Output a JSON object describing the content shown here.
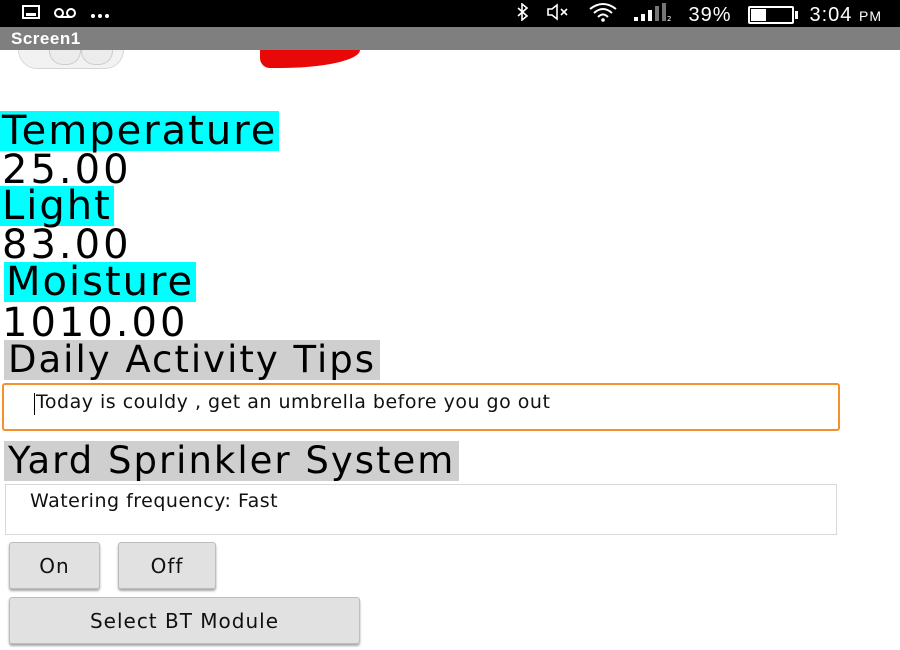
{
  "status_bar": {
    "left_icons": [
      "image-icon",
      "voicemail-icon",
      "more-dots-icon"
    ],
    "right_icons": [
      "bluetooth-icon",
      "mute-icon",
      "wifi-icon",
      "signal-icon"
    ],
    "battery_text": "39%",
    "battery_level": 0.39,
    "time": "3:04",
    "ampm": "PM"
  },
  "title_bar": {
    "title": "Screen1"
  },
  "sensors": {
    "temperature": {
      "label": "Temperature",
      "value": "25.00"
    },
    "light": {
      "label": "Light",
      "value": "83.00"
    },
    "moisture": {
      "label": "Moisture",
      "value": "1010.00"
    }
  },
  "tips": {
    "heading": "Daily Activity Tips",
    "text": "Today is couldy , get an umbrella before you go out"
  },
  "sprinkler": {
    "heading": "Yard Sprinkler System",
    "frequency_text": "Watering frequency: Fast",
    "on_label": "On",
    "off_label": "Off",
    "select_bt_label": "Select BT Module"
  },
  "colors": {
    "label_highlight": "#00ffff",
    "section_highlight": "#cfcfcf",
    "focus_border": "#f5902a",
    "title_bar": "#7f7f7f"
  }
}
